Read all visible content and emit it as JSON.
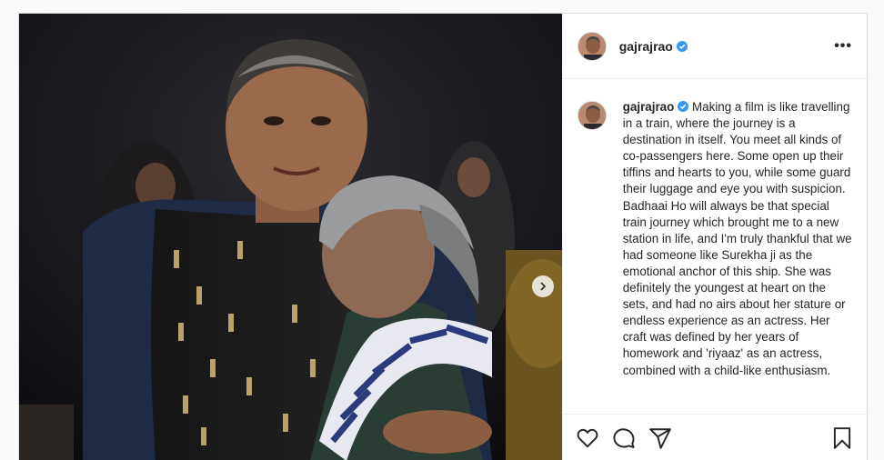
{
  "post": {
    "username": "gajrajrao",
    "verified": true,
    "more_label": "•••",
    "caption": "Making a film is like travelling in a train, where the journey is a destination in itself. You meet all kinds of co-passengers here. Some open up their tiffins and hearts to you, while some guard their luggage and eye you with suspicion. Badhaai Ho will always be that special train journey which brought me to a new station in life, and I'm truly thankful that we had someone like Surekha ji as the emotional anchor of this ship. She was definitely the youngest at heart on the sets, and had no airs about her stature or endless experience as an actress. Her craft was defined by her years of homework and 'riyaaz' as an actress, combined with a child-like enthusiasm.",
    "icons": {
      "like": "heart-icon",
      "comment": "comment-icon",
      "share": "paper-plane-icon",
      "save": "bookmark-icon",
      "next": "chevron-right-icon",
      "verified": "verified-badge-icon"
    },
    "colors": {
      "verified": "#3897f0",
      "border": "#dbdbdb",
      "text": "#262626"
    }
  }
}
